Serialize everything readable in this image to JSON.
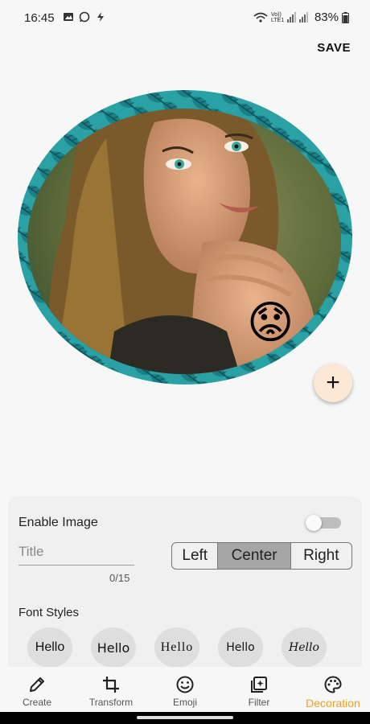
{
  "status": {
    "time": "16:45",
    "battery": "83%",
    "lte": "Vo)) LTE1"
  },
  "header": {
    "save_label": "SAVE"
  },
  "editor": {
    "sticker": "😟"
  },
  "panel": {
    "enable_image_label": "Enable Image",
    "title_placeholder": "Title",
    "title_value": "",
    "counter": "0/15",
    "alignment": [
      {
        "label": "Left"
      },
      {
        "label": "Center"
      },
      {
        "label": "Right"
      }
    ],
    "selected_alignment": "Center",
    "font_styles_label": "Font Styles",
    "fonts": [
      {
        "label": "Hello"
      },
      {
        "label": "Hello"
      },
      {
        "label": "Hello"
      },
      {
        "label": "Hello"
      },
      {
        "label": "Hello"
      }
    ]
  },
  "nav": {
    "items": [
      {
        "label": "Create",
        "icon": "pencil-icon"
      },
      {
        "label": "Transform",
        "icon": "crop-icon"
      },
      {
        "label": "Emoji",
        "icon": "smiley-icon"
      },
      {
        "label": "Filter",
        "icon": "filter-icon"
      },
      {
        "label": "Decoration",
        "icon": "palette-icon"
      }
    ],
    "active": "Decoration",
    "active_color": "#f0a020"
  },
  "colors": {
    "frame": "#2aa1a4",
    "accent": "#f0a020",
    "fab_bg": "#fde8d6"
  }
}
